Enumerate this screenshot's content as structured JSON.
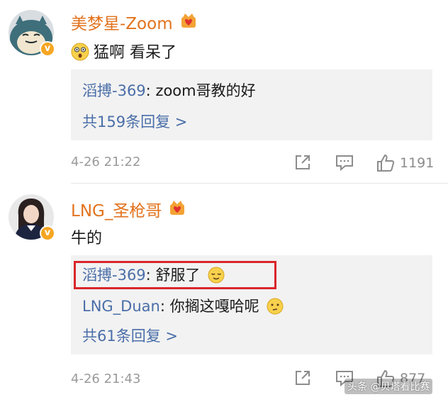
{
  "comments": [
    {
      "username": "美梦星-Zoom",
      "avatar_icon": "snorlax-avatar",
      "badge_icon": "crown-heart-icon",
      "verified": "v",
      "text": "猛啊 看呆了",
      "text_emoji": "astonished-face-emoji",
      "replies": [
        {
          "author": "滔搏-369",
          "separator": ": ",
          "text": "zoom哥教的好"
        }
      ],
      "more_replies": "共159条回复 >",
      "timestamp": "4-26 21:22",
      "like_count": "1191"
    },
    {
      "username": "LNG_圣枪哥",
      "avatar_icon": "person-photo-avatar",
      "badge_icon": "crown-heart-icon",
      "verified": "v",
      "text": "牛的",
      "replies": [
        {
          "author": "滔搏-369",
          "separator": ": ",
          "text": "舒服了",
          "emoji": "relieved-face-emoji"
        },
        {
          "author": "LNG_Duan",
          "separator": ": ",
          "text": "你搁这嘎哈呢",
          "emoji": "thinking-face-emoji"
        }
      ],
      "more_replies": "共61条回复 >",
      "timestamp": "4-26 21:43",
      "like_count": "877"
    }
  ],
  "watermark": "头条 @贝塔看比赛",
  "colors": {
    "username": "#e2721c",
    "reply_author": "#4a6ea8",
    "highlight": "#d9262b",
    "reply_bg": "#f2f2f2",
    "meta": "#9a9a9a"
  }
}
